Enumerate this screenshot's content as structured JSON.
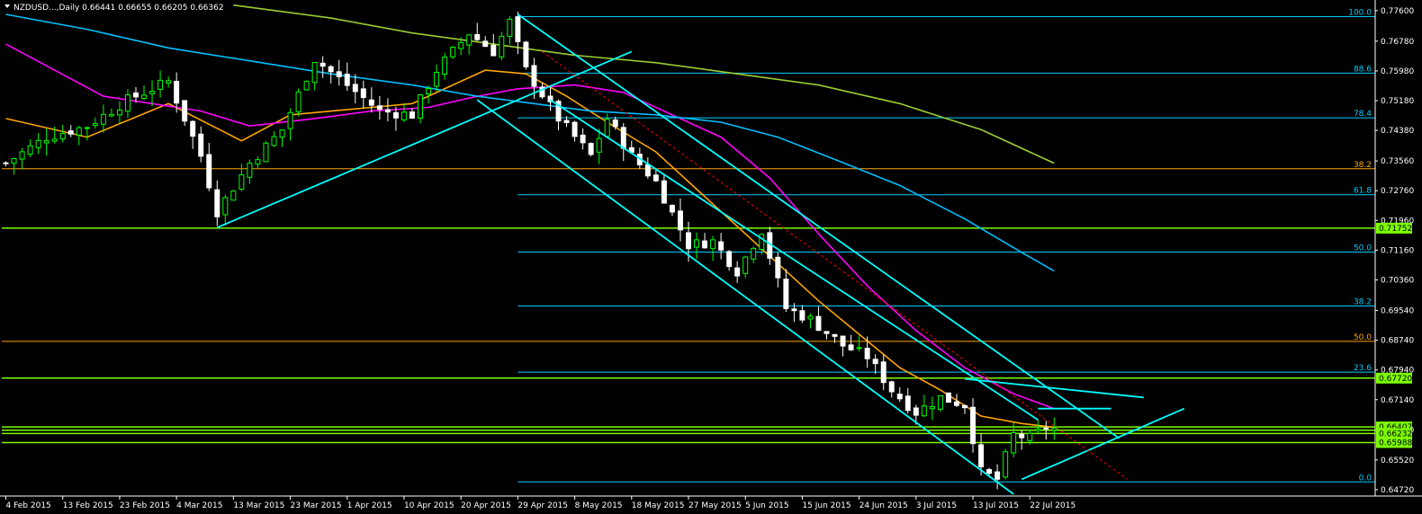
{
  "header": {
    "symbol": "NZDUSD...",
    "timeframe": "Daily",
    "ohlc": "0.66441 0.66655 0.66205 0.66362"
  },
  "colors": {
    "background": "#000000",
    "axis": "#FFFFFF",
    "text": "#FFFFFF",
    "bull": "#00FF00",
    "bear": "#FFFFFF",
    "ma_short": "#FFA500",
    "ma_mid": "#FF00FF",
    "ma_long": "#00BFFF",
    "ma_vlong": "#9ACD32",
    "fibo_a": "#00CCFF",
    "fibo_b": "#FFA500",
    "channel": "#00FFFF",
    "sr_line": "#7CFC00",
    "price_tag_bg": "#7CFC00",
    "price_tag_text": "#000000",
    "forecast": "#FF0000"
  },
  "chart_data": {
    "type": "candlestick",
    "title": "NZDUSD...,Daily",
    "ylim": [
      0.6455,
      0.7779
    ],
    "y_ticks": [
      "0.77600",
      "0.76780",
      "0.75980",
      "0.75180",
      "0.74380",
      "0.73560",
      "0.72760",
      "0.71960",
      "0.71160",
      "0.70360",
      "0.69540",
      "0.68740",
      "0.67940",
      "0.67140",
      "0.66320",
      "0.65520",
      "0.64720"
    ],
    "x_labels": [
      {
        "i": 0,
        "label": "4 Feb 2015"
      },
      {
        "i": 7,
        "label": "13 Feb 2015"
      },
      {
        "i": 14,
        "label": "23 Feb 2015"
      },
      {
        "i": 21,
        "label": "4 Mar 2015"
      },
      {
        "i": 28,
        "label": "13 Mar 2015"
      },
      {
        "i": 35,
        "label": "23 Mar 2015"
      },
      {
        "i": 42,
        "label": "1 Apr 2015"
      },
      {
        "i": 49,
        "label": "10 Apr 2015"
      },
      {
        "i": 56,
        "label": "20 Apr 2015"
      },
      {
        "i": 63,
        "label": "29 Apr 2015"
      },
      {
        "i": 70,
        "label": "8 May 2015"
      },
      {
        "i": 77,
        "label": "18 May 2015"
      },
      {
        "i": 84,
        "label": "27 May 2015"
      },
      {
        "i": 91,
        "label": "5 Jun 2015"
      },
      {
        "i": 98,
        "label": "15 Jun 2015"
      },
      {
        "i": 105,
        "label": "24 Jun 2015"
      },
      {
        "i": 112,
        "label": "3 Jul 2015"
      },
      {
        "i": 119,
        "label": "13 Jul 2015"
      },
      {
        "i": 126,
        "label": "22 Jul 2015"
      }
    ],
    "x_span": [
      -0.5,
      168.5
    ],
    "candle_count": 130,
    "close_path": [
      [
        0,
        0.735
      ],
      [
        5,
        0.742
      ],
      [
        10,
        0.745
      ],
      [
        15,
        0.752
      ],
      [
        20,
        0.757
      ],
      [
        24,
        0.737
      ],
      [
        26,
        0.722
      ],
      [
        30,
        0.735
      ],
      [
        34,
        0.744
      ],
      [
        38,
        0.763
      ],
      [
        42,
        0.756
      ],
      [
        46,
        0.749
      ],
      [
        50,
        0.748
      ],
      [
        53,
        0.76
      ],
      [
        57,
        0.77
      ],
      [
        60,
        0.765
      ],
      [
        62,
        0.773
      ],
      [
        64,
        0.76
      ],
      [
        68,
        0.747
      ],
      [
        72,
        0.737
      ],
      [
        74,
        0.747
      ],
      [
        77,
        0.737
      ],
      [
        80,
        0.73
      ],
      [
        84,
        0.713
      ],
      [
        87,
        0.714
      ],
      [
        90,
        0.706
      ],
      [
        93,
        0.717
      ],
      [
        96,
        0.696
      ],
      [
        99,
        0.693
      ],
      [
        103,
        0.686
      ],
      [
        106,
        0.683
      ],
      [
        109,
        0.674
      ],
      [
        112,
        0.668
      ],
      [
        115,
        0.672
      ],
      [
        118,
        0.67
      ],
      [
        120,
        0.652
      ],
      [
        122,
        0.65
      ],
      [
        124,
        0.662
      ],
      [
        126,
        0.661
      ],
      [
        128,
        0.664
      ],
      [
        129,
        0.6636
      ]
    ],
    "moving_averages": [
      {
        "points": [
          [
            0,
            0.747
          ],
          [
            10,
            0.742
          ],
          [
            20,
            0.751
          ],
          [
            29,
            0.741
          ],
          [
            35,
            0.748
          ],
          [
            45,
            0.75
          ],
          [
            50,
            0.751
          ],
          [
            55,
            0.756
          ],
          [
            59,
            0.76
          ],
          [
            64,
            0.759
          ],
          [
            69,
            0.753
          ],
          [
            74,
            0.746
          ],
          [
            80,
            0.738
          ],
          [
            85,
            0.728
          ],
          [
            90,
            0.718
          ],
          [
            95,
            0.708
          ],
          [
            100,
            0.698
          ],
          [
            105,
            0.689
          ],
          [
            110,
            0.68
          ],
          [
            115,
            0.674
          ],
          [
            120,
            0.667
          ],
          [
            125,
            0.665
          ],
          [
            129,
            0.664
          ]
        ]
      },
      {
        "points": [
          [
            0,
            0.767
          ],
          [
            6,
            0.76
          ],
          [
            12,
            0.753
          ],
          [
            18,
            0.751
          ],
          [
            24,
            0.749
          ],
          [
            30,
            0.745
          ],
          [
            38,
            0.747
          ],
          [
            45,
            0.749
          ],
          [
            52,
            0.75
          ],
          [
            58,
            0.753
          ],
          [
            63,
            0.755
          ],
          [
            70,
            0.756
          ],
          [
            76,
            0.754
          ],
          [
            82,
            0.748
          ],
          [
            88,
            0.742
          ],
          [
            94,
            0.731
          ],
          [
            100,
            0.716
          ],
          [
            106,
            0.702
          ],
          [
            112,
            0.69
          ],
          [
            118,
            0.68
          ],
          [
            124,
            0.673
          ],
          [
            129,
            0.669
          ]
        ]
      },
      {
        "points": [
          [
            0,
            0.775
          ],
          [
            10,
            0.771
          ],
          [
            20,
            0.766
          ],
          [
            30,
            0.7625
          ],
          [
            40,
            0.759
          ],
          [
            50,
            0.756
          ],
          [
            58,
            0.753
          ],
          [
            65,
            0.751
          ],
          [
            72,
            0.749
          ],
          [
            80,
            0.748
          ],
          [
            88,
            0.746
          ],
          [
            95,
            0.742
          ],
          [
            102,
            0.736
          ],
          [
            110,
            0.729
          ],
          [
            118,
            0.72
          ],
          [
            125,
            0.711
          ],
          [
            129,
            0.706
          ]
        ]
      },
      {
        "points": [
          [
            28,
            0.7775
          ],
          [
            40,
            0.774
          ],
          [
            50,
            0.77
          ],
          [
            60,
            0.767
          ],
          [
            70,
            0.764
          ],
          [
            80,
            0.762
          ],
          [
            90,
            0.759
          ],
          [
            100,
            0.756
          ],
          [
            110,
            0.751
          ],
          [
            120,
            0.744
          ],
          [
            129,
            0.735
          ]
        ]
      }
    ],
    "levels": [
      {
        "label": "100.0",
        "value": 0.7744,
        "start_i": 63,
        "color_key": "fibo_a"
      },
      {
        "label": "88.6",
        "value": 0.7592,
        "start_i": 63,
        "color_key": "fibo_a"
      },
      {
        "label": "78.4",
        "value": 0.7472,
        "start_i": 63,
        "color_key": "fibo_a"
      },
      {
        "label": "38.2",
        "value": 0.7335,
        "start_i": -0.5,
        "color_key": "fibo_b"
      },
      {
        "label": "61.8",
        "value": 0.7265,
        "start_i": 63,
        "color_key": "fibo_a"
      },
      {
        "label": "50.0",
        "value": 0.7111,
        "start_i": 63,
        "color_key": "fibo_a"
      },
      {
        "label": "38.2",
        "value": 0.6966,
        "start_i": 63,
        "color_key": "fibo_a"
      },
      {
        "label": "50.0",
        "value": 0.6871,
        "start_i": -0.5,
        "color_key": "fibo_b"
      },
      {
        "label": "23.6",
        "value": 0.6788,
        "start_i": 63,
        "color_key": "fibo_a"
      },
      {
        "label": "0.0",
        "value": 0.6493,
        "start_i": 63,
        "color_key": "fibo_a"
      }
    ],
    "hlines": [
      0.71752,
      0.6772,
      0.66407,
      0.6632,
      0.66232,
      0.65988
    ],
    "price_tags": [
      {
        "text": "0.71752",
        "value": 0.71752
      },
      {
        "text": "0.67720",
        "value": 0.6772
      },
      {
        "text": "0.66407",
        "value": 0.66407
      },
      {
        "text": "0.66232",
        "value": 0.66232
      },
      {
        "text": "0.65988",
        "value": 0.65988
      }
    ],
    "trendlines": [
      [
        [
          26,
          0.7177
        ],
        [
          77,
          0.765
        ]
      ],
      [
        [
          58,
          0.752
        ],
        [
          124,
          0.646
        ]
      ],
      [
        [
          63,
          0.775
        ],
        [
          137,
          0.661
        ]
      ],
      [
        [
          67,
          0.752
        ],
        [
          127,
          0.666
        ]
      ],
      [
        [
          118,
          0.677
        ],
        [
          140,
          0.672
        ]
      ],
      [
        [
          125,
          0.65
        ],
        [
          145,
          0.669
        ]
      ],
      [
        [
          127,
          0.669
        ],
        [
          136,
          0.669
        ]
      ]
    ],
    "forecast_line": [
      [
        66,
        0.765
      ],
      [
        138,
        0.65
      ]
    ]
  }
}
